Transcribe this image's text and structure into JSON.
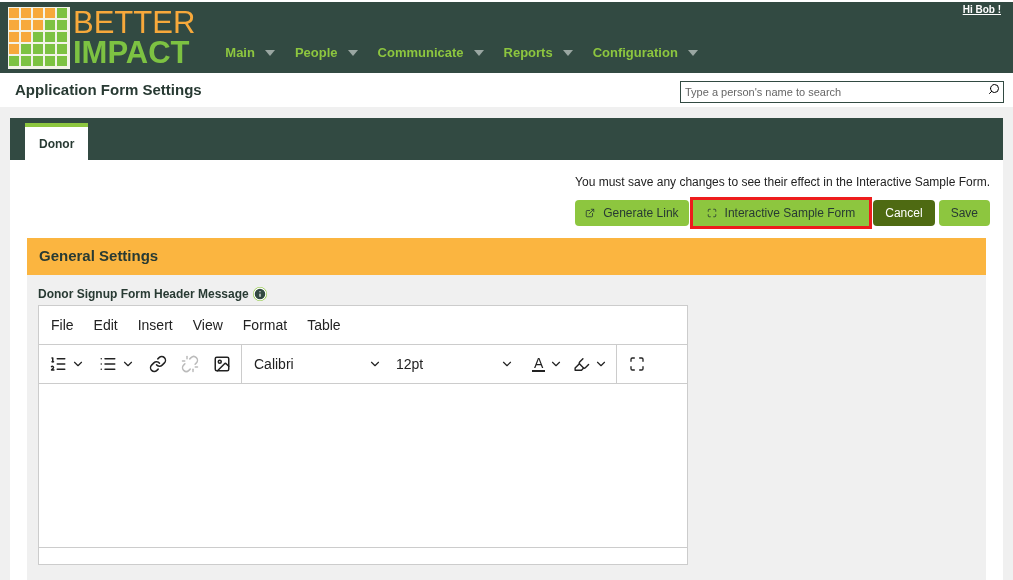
{
  "header": {
    "logo_top": "BETTER",
    "logo_bottom": "IMPACT",
    "greeting": "Hi Bob !",
    "nav": [
      {
        "label": "Main"
      },
      {
        "label": "People"
      },
      {
        "label": "Communicate"
      },
      {
        "label": "Reports"
      },
      {
        "label": "Configuration"
      }
    ]
  },
  "page_title": "Application Form Settings",
  "search": {
    "placeholder": "Type a person's name to search"
  },
  "tabs": [
    {
      "label": "Donor",
      "selected": true
    }
  ],
  "notice": "You must save any changes to see their effect in the Interactive Sample Form.",
  "buttons": [
    {
      "label": "Generate Link",
      "kind": "link",
      "highlighted": false
    },
    {
      "label": "Interactive Sample Form",
      "kind": "window",
      "highlighted": true
    },
    {
      "label": "Cancel",
      "kind": "cancel",
      "highlighted": false
    },
    {
      "label": "Save",
      "kind": "save",
      "highlighted": false
    }
  ],
  "section": {
    "title": "General Settings",
    "field_label": "Donor Signup Form Header Message",
    "editor": {
      "menu": [
        "File",
        "Edit",
        "Insert",
        "View",
        "Format",
        "Table"
      ],
      "font": "Calibri",
      "size": "12pt",
      "text_color_glyph": "A",
      "toolbar": [
        {
          "kind": "numbered-list",
          "disabled": false
        },
        {
          "kind": "bullet-list",
          "disabled": false
        },
        {
          "kind": "link",
          "disabled": false
        },
        {
          "kind": "unlink",
          "disabled": true
        },
        {
          "kind": "image",
          "disabled": false
        }
      ]
    }
  }
}
